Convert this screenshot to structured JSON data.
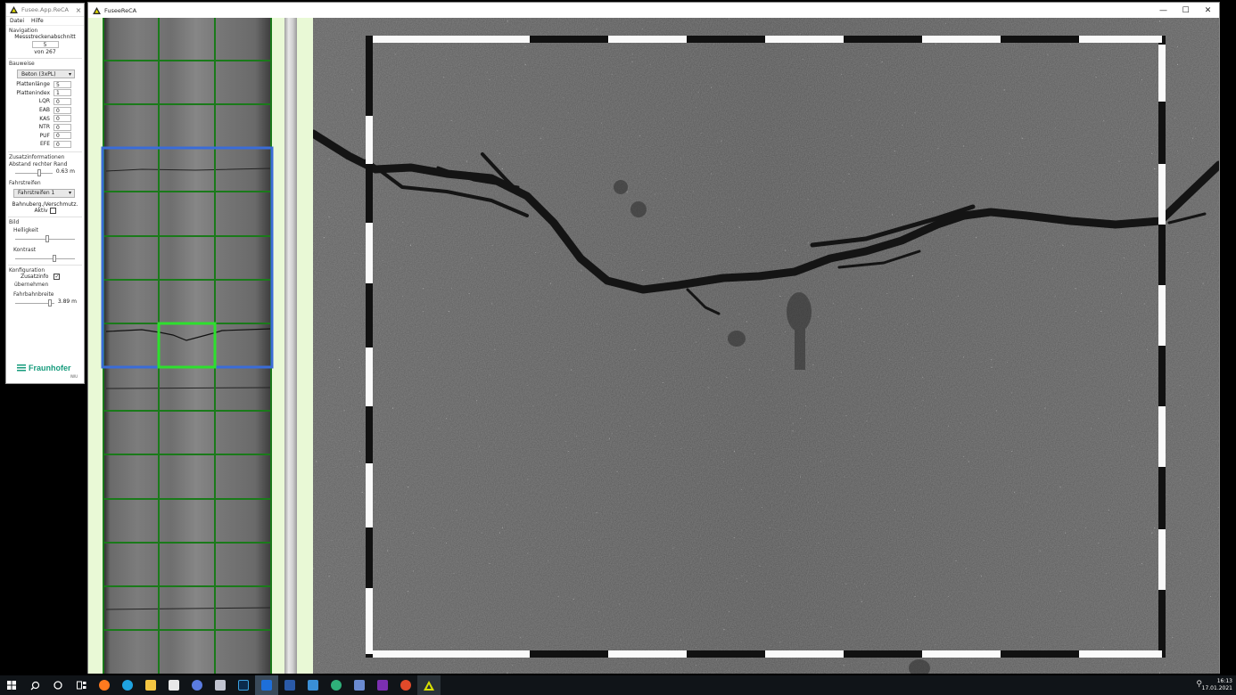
{
  "panel": {
    "title": "Fusee.App.ReCA",
    "close": "×",
    "menu": [
      "Datei",
      "Hilfe"
    ],
    "navigation": {
      "title": "Navigation",
      "label": "Messstreckenabschnitt",
      "value": "5",
      "of_text": "von 267"
    },
    "bauweise": {
      "title": "Bauweise",
      "select_value": "Beton (3xPL)",
      "fields": [
        {
          "label": "Plattenlänge",
          "value": "5"
        },
        {
          "label": "Plattenindex",
          "value": "1"
        },
        {
          "label": "LQR",
          "value": "0"
        },
        {
          "label": "EAB",
          "value": "0"
        },
        {
          "label": "KAS",
          "value": "0"
        },
        {
          "label": "NTR",
          "value": "0"
        },
        {
          "label": "PUF",
          "value": "0"
        },
        {
          "label": "EFE",
          "value": "0"
        }
      ]
    },
    "zusatz": {
      "title": "Zusatzinformationen",
      "abstand_label": "Abstand rechter Rand",
      "abstand_value": "0.63 m",
      "fahrstreifen_label": "Fahrstreifen",
      "fahrstreifen_value": "Fahrstreifen 1",
      "bahnuberg_label": "Bahnuberg./Verschmutz.",
      "aktiv_label": "Aktiv"
    },
    "bild": {
      "title": "Bild",
      "helligkeit_label": "Helligkeit",
      "kontrast_label": "Kontrast"
    },
    "konfiguration": {
      "title": "Konfiguration",
      "zusatzinfo_label_1": "Zusatzinfo",
      "zusatzinfo_label_2": "übernehmen",
      "zusatzinfo_checked": "✓",
      "fahrbahnbreite_label": "Fahrbahnbreite",
      "fahrbahnbreite_value": "3.89 m"
    },
    "logo": {
      "word": "Fraunhofer",
      "sub": "IWU"
    }
  },
  "mainwin": {
    "title": "FuseeReCA",
    "minimize": "—",
    "maximize": "☐",
    "close": "✕"
  },
  "taskbar": {
    "time": "16:13",
    "date": "17.01.2021",
    "apps": [
      {
        "name": "start-icon",
        "color": "#ffffff"
      },
      {
        "name": "search-icon",
        "color": "#ffffff"
      },
      {
        "name": "cortana-icon",
        "color": "#ffffff"
      },
      {
        "name": "task-view-icon",
        "color": "#ffffff"
      },
      {
        "name": "firefox-icon",
        "color": "#ff7a1f"
      },
      {
        "name": "edge-icon",
        "color": "#1fa3e0"
      },
      {
        "name": "explorer-icon",
        "color": "#f4c542"
      },
      {
        "name": "store-icon",
        "color": "#f0f0f0"
      },
      {
        "name": "app-icon",
        "color": "#5a7be0"
      },
      {
        "name": "teams-icon",
        "color": "#c0c4d0"
      },
      {
        "name": "lightroom-icon",
        "color": "#0b2b4c"
      },
      {
        "name": "outlook-icon",
        "color": "#1e6fd9"
      },
      {
        "name": "powershell-icon",
        "color": "#2a5aa8"
      },
      {
        "name": "vscode-icon",
        "color": "#3a8fd6"
      },
      {
        "name": "globe-icon",
        "color": "#2fb07a"
      },
      {
        "name": "network-icon",
        "color": "#6a8ad0"
      },
      {
        "name": "onenote-icon",
        "color": "#7b2fb0"
      },
      {
        "name": "record-icon",
        "color": "#e04a2a"
      },
      {
        "name": "fuseereca-icon",
        "color": "#d8e000"
      }
    ]
  }
}
